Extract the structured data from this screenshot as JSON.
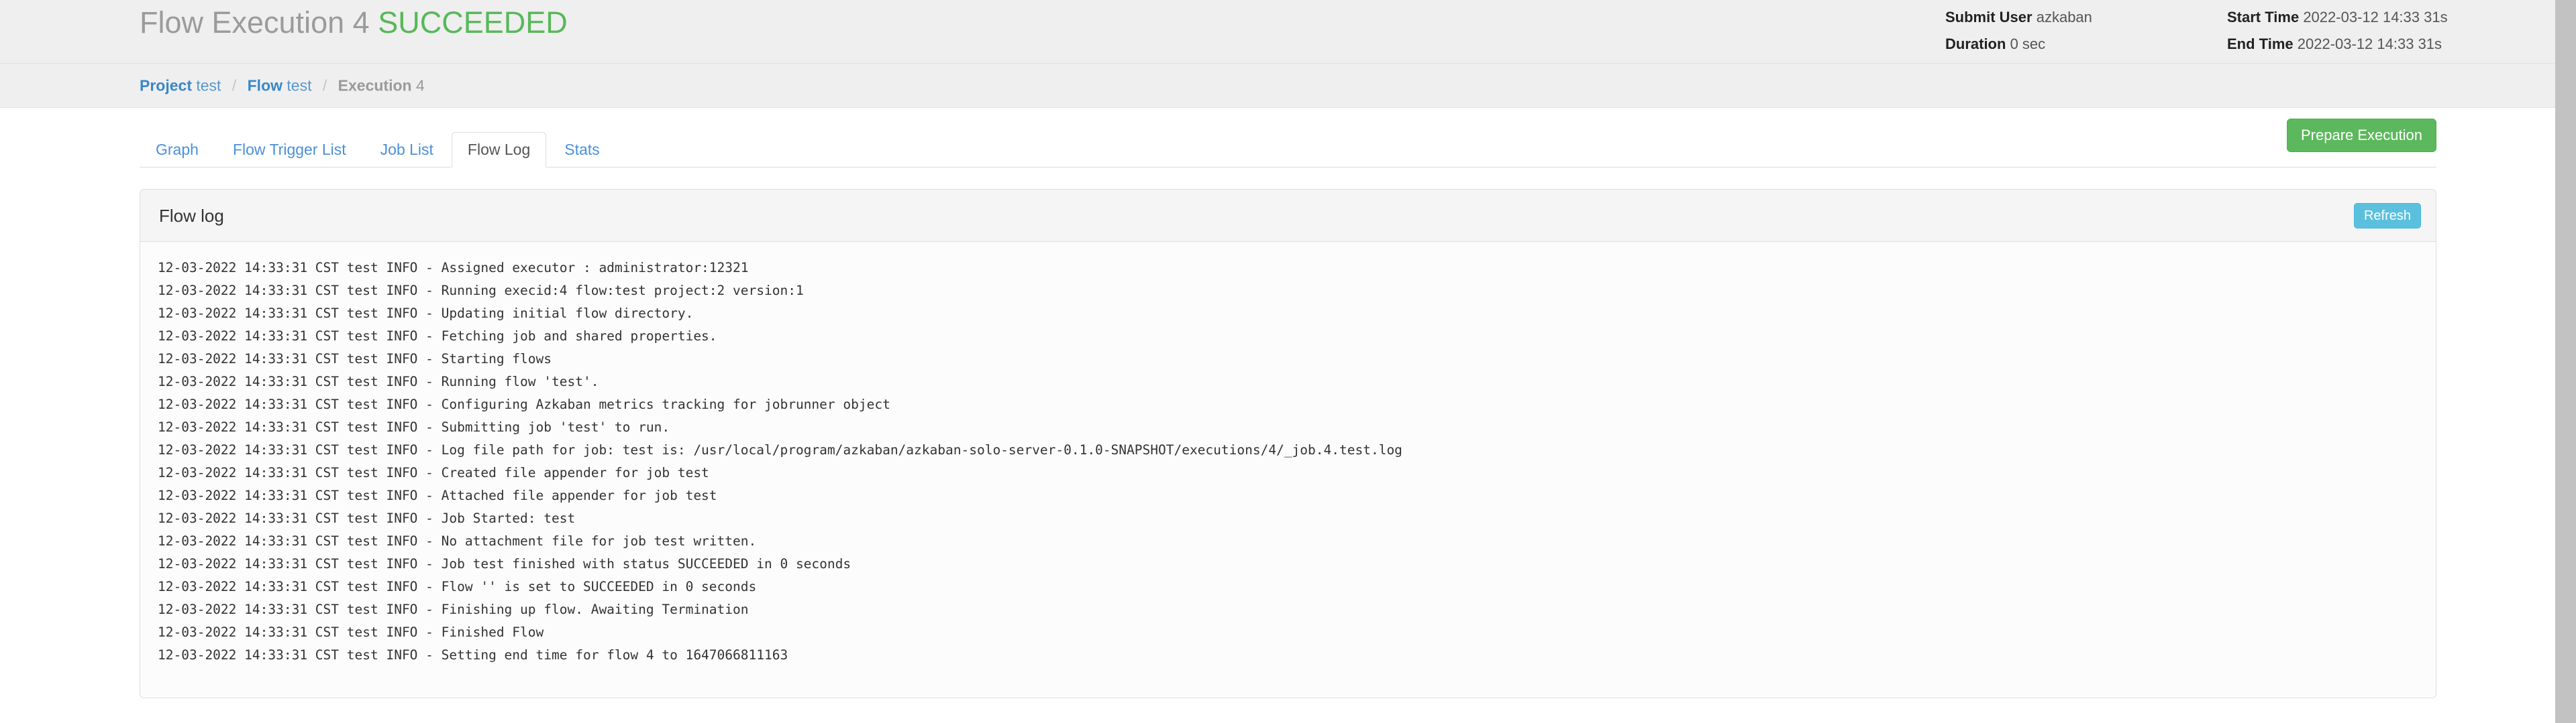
{
  "header": {
    "title_prefix": "Flow Execution 4",
    "status": "SUCCEEDED",
    "status_color": "#58b85a",
    "meta": {
      "submit_user_label": "Submit User",
      "submit_user_value": "azkaban",
      "duration_label": "Duration",
      "duration_value": "0 sec",
      "start_time_label": "Start Time",
      "start_time_value": "2022-03-12 14:33 31s",
      "end_time_label": "End Time",
      "end_time_value": "2022-03-12 14:33 31s"
    }
  },
  "breadcrumb": {
    "project_label": "Project",
    "project_value": "test",
    "sep1": "/",
    "flow_label": "Flow",
    "flow_value": "test",
    "sep2": "/",
    "execution_label": "Execution",
    "execution_value": "4"
  },
  "tabs": [
    {
      "label": "Graph",
      "active": false
    },
    {
      "label": "Flow Trigger List",
      "active": false
    },
    {
      "label": "Job List",
      "active": false
    },
    {
      "label": "Flow Log",
      "active": true
    },
    {
      "label": "Stats",
      "active": false
    }
  ],
  "actions": {
    "prepare_execution_label": "Prepare Execution",
    "prepare_execution_color": "#5cb85c",
    "refresh_label": "Refresh",
    "refresh_color": "#5bc0de"
  },
  "panel": {
    "title": "Flow log",
    "log_lines": [
      "12-03-2022 14:33:31 CST test INFO - Assigned executor : administrator:12321",
      "12-03-2022 14:33:31 CST test INFO - Running execid:4 flow:test project:2 version:1",
      "12-03-2022 14:33:31 CST test INFO - Updating initial flow directory.",
      "12-03-2022 14:33:31 CST test INFO - Fetching job and shared properties.",
      "12-03-2022 14:33:31 CST test INFO - Starting flows",
      "12-03-2022 14:33:31 CST test INFO - Running flow 'test'.",
      "12-03-2022 14:33:31 CST test INFO - Configuring Azkaban metrics tracking for jobrunner object",
      "12-03-2022 14:33:31 CST test INFO - Submitting job 'test' to run.",
      "12-03-2022 14:33:31 CST test INFO - Log file path for job: test is: /usr/local/program/azkaban/azkaban-solo-server-0.1.0-SNAPSHOT/executions/4/_job.4.test.log",
      "12-03-2022 14:33:31 CST test INFO - Created file appender for job test",
      "12-03-2022 14:33:31 CST test INFO - Attached file appender for job test",
      "12-03-2022 14:33:31 CST test INFO - Job Started: test",
      "12-03-2022 14:33:31 CST test INFO - No attachment file for job test written.",
      "12-03-2022 14:33:31 CST test INFO - Job test finished with status SUCCEEDED in 0 seconds",
      "12-03-2022 14:33:31 CST test INFO - Flow '' is set to SUCCEEDED in 0 seconds",
      "12-03-2022 14:33:31 CST test INFO - Finishing up flow. Awaiting Termination",
      "12-03-2022 14:33:31 CST test INFO - Finished Flow",
      "12-03-2022 14:33:31 CST test INFO - Setting end time for flow 4 to 1647066811163"
    ]
  }
}
